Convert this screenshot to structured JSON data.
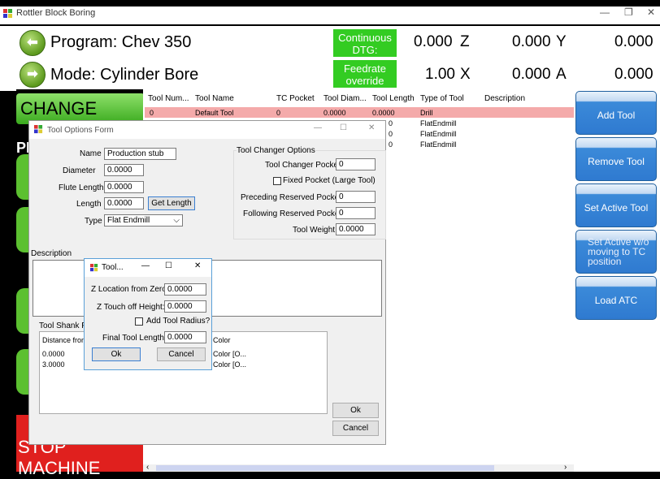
{
  "window": {
    "title": "Rottler Block Boring"
  },
  "header": {
    "program_label": "Program: Chev 350",
    "mode_label": "Mode: Cylinder Bore",
    "continuous_dtg": "Continuous DTG:",
    "feedrate_override": "Feedrate override",
    "dtg_value": "0.000",
    "feedrate_value": "1.00",
    "axes": [
      {
        "name": "Z",
        "value": "0.000"
      },
      {
        "name": "Y",
        "value": "0.000"
      },
      {
        "name": "X",
        "value": "0.000"
      },
      {
        "name": "A",
        "value": "0.000"
      }
    ]
  },
  "left": {
    "change_tool": "CHANGE TOOL",
    "partial_pr": "PI",
    "stop_machine": "STOP MACHINE"
  },
  "table": {
    "columns": [
      "Tool Num...",
      "Tool Name",
      "TC Pocket",
      "Tool Diam...",
      "Tool Length",
      "Type of Tool",
      "Description"
    ],
    "rows": [
      {
        "num": "0",
        "name": "Default Tool",
        "pocket": "0",
        "diam": "0.0000",
        "length": "0.0000",
        "type": "Drill"
      },
      {
        "num": "0",
        "type": "FlatEndmill"
      },
      {
        "num": "0",
        "type": "FlatEndmill"
      },
      {
        "num": "0",
        "type": "FlatEndmill"
      }
    ]
  },
  "right": {
    "add_tool": "Add Tool",
    "remove_tool": "Remove Tool",
    "set_active_tool": "Set Active Tool",
    "set_active_wo": "Set Active w/o moving to TC position",
    "load_atc": "Load ATC"
  },
  "form": {
    "title": "Tool Options Form",
    "name_label": "Name",
    "name_value": "Production stub",
    "diameter_label": "Diameter",
    "diameter_value": "0.0000",
    "flute_label": "Flute Length",
    "flute_value": "0.0000",
    "length_label": "Length",
    "length_value": "0.0000",
    "get_length": "Get Length",
    "type_label": "Type",
    "type_value": "Flat Endmill",
    "tc_group": "Tool Changer Options",
    "tc_pocket_label": "Tool Changer Pocket",
    "tc_pocket_value": "0",
    "fixed_pocket": "Fixed Pocket (Large Tool)",
    "preceding_label": "Preceding Reserved Pockets",
    "preceding_value": "0",
    "following_label": "Following Reserved Pockets",
    "following_value": "0",
    "weight_label": "Tool Weight",
    "weight_value": "0.0000",
    "description_label": "Description",
    "shank_label": "Tool Shank Pro",
    "shank_col1": "Distance from",
    "shank_col2": "Color",
    "shank_rows": [
      {
        "dist": "0.0000",
        "color": "Color [O..."
      },
      {
        "dist": "3.0000",
        "color": "Color [O..."
      }
    ],
    "ok": "Ok",
    "cancel": "Cancel"
  },
  "tool_dialog": {
    "title": "Tool...",
    "z_location_label": "Z Location from Zero:",
    "z_location_value": "0.0000",
    "z_touch_label": "Z Touch off Height:",
    "z_touch_value": "0.0000",
    "add_radius": "Add Tool Radius?",
    "final_length_label": "Final Tool Length:",
    "final_length_value": "0.0000",
    "ok": "Ok",
    "cancel": "Cancel"
  }
}
